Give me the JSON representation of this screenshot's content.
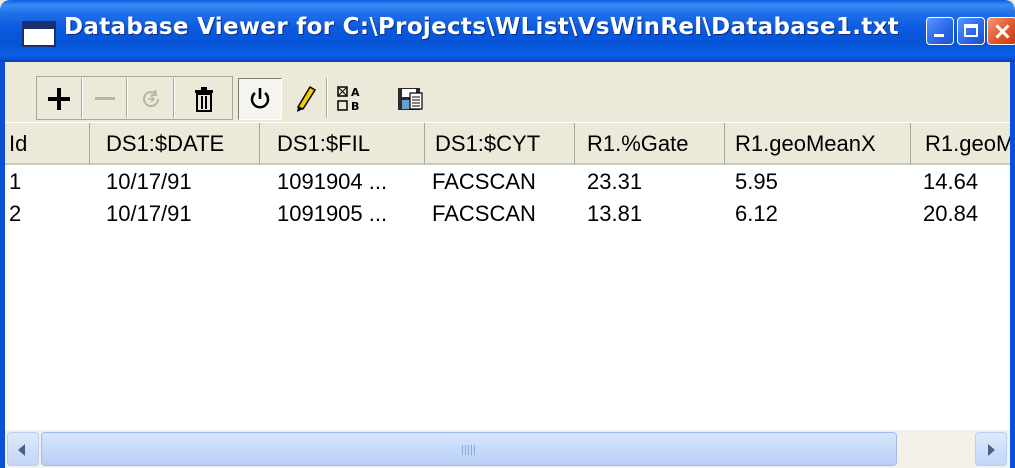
{
  "window": {
    "title": "Database Viewer for C:\\Projects\\WList\\VsWinRel\\Database1.txt"
  },
  "toolbar": {
    "buttons": [
      {
        "name": "add-record",
        "icon": "plus-icon"
      },
      {
        "name": "delete-record",
        "icon": "minus-icon"
      },
      {
        "name": "refresh",
        "icon": "refresh-icon"
      },
      {
        "name": "trash",
        "icon": "trash-icon"
      },
      {
        "name": "power",
        "icon": "power-icon"
      },
      {
        "name": "edit",
        "icon": "pencil-icon"
      },
      {
        "name": "sort",
        "icon": "sort-icon"
      },
      {
        "name": "save",
        "icon": "save-icon"
      }
    ]
  },
  "grid": {
    "columns": [
      "Id",
      "DS1:$DATE",
      "DS1:$FIL",
      "DS1:$CYT",
      "R1.%Gate",
      "R1.geoMeanX",
      "R1.geoM"
    ],
    "rows": [
      [
        "1",
        "10/17/91",
        "1091904 ...",
        "FACSCAN",
        "23.31",
        "5.95",
        "14.64"
      ],
      [
        "2",
        "10/17/91",
        "1091905 ...",
        "FACSCAN",
        "13.81",
        "6.12",
        "20.84"
      ]
    ]
  },
  "colors": {
    "titlebar": "#0a5fe6",
    "window_bg": "#ece9d8",
    "scroll_thumb": "#c7d9fa",
    "close_button": "#e0562c"
  }
}
